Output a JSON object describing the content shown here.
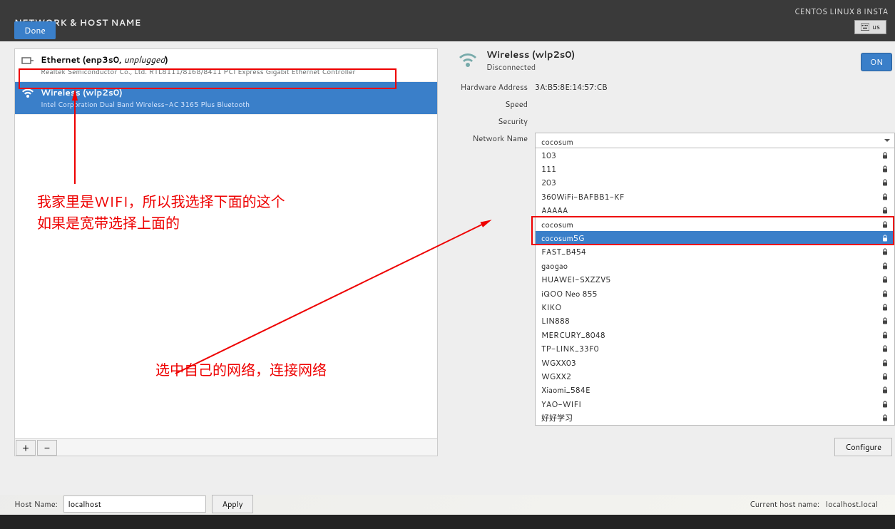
{
  "topbar": {
    "title": "NETWORK & HOST NAME",
    "distro": "CENTOS LINUX 8 INSTA",
    "keyboard": "us",
    "done_label": "Done"
  },
  "devices": [
    {
      "name": "Ethernet (enp3s0, ",
      "unplugged": "unplugged",
      "nameSuffix": ")",
      "sub": "Realtek Semiconductor Co., Ltd. RTL8111/8168/8411 PCI Express Gigabit Ethernet Controller",
      "selected": false,
      "iconType": "ethernet"
    },
    {
      "name": "Wireless (wlp2s0)",
      "unplugged": "",
      "nameSuffix": "",
      "sub": "Intel Corporation Dual Band Wireless-AC 3165 Plus Bluetooth",
      "selected": true,
      "iconType": "wifi"
    }
  ],
  "toolbar": {
    "add": "+",
    "remove": "−"
  },
  "details": {
    "title": "Wireless (wlp2s0)",
    "status": "Disconnected",
    "on_label": "ON",
    "rows": {
      "hw_label": "Hardware Address",
      "hw_value": "3A:B5:8E:14:57:CB",
      "speed_label": "Speed",
      "speed_value": "",
      "security_label": "Security",
      "security_value": "",
      "network_label": "Network Name",
      "network_selected": "cocosum"
    },
    "configure_label": "Configure"
  },
  "networks": [
    {
      "name": "103",
      "locked": true
    },
    {
      "name": "111",
      "locked": true
    },
    {
      "name": "203",
      "locked": true
    },
    {
      "name": "360WiFi-BAFBB1-KF",
      "locked": true
    },
    {
      "name": "AAAAA",
      "locked": true
    },
    {
      "name": "cocosum",
      "locked": true,
      "boxed": true
    },
    {
      "name": "cocosum5G",
      "locked": true,
      "highlighted": true
    },
    {
      "name": "FAST_B454",
      "locked": true
    },
    {
      "name": "gaogao",
      "locked": true
    },
    {
      "name": "HUAWEI-SXZZV5",
      "locked": true
    },
    {
      "name": "iQOO Neo 855",
      "locked": true
    },
    {
      "name": "KIKO",
      "locked": true
    },
    {
      "name": "LIN888",
      "locked": true
    },
    {
      "name": "MERCURY_8048",
      "locked": true
    },
    {
      "name": "TP-LINK_33F0",
      "locked": true
    },
    {
      "name": "WGXX03",
      "locked": true
    },
    {
      "name": "WGXX2",
      "locked": true
    },
    {
      "name": "Xiaomi_584E",
      "locked": true
    },
    {
      "name": "YAO-WIFI",
      "locked": true
    },
    {
      "name": "好好学习",
      "locked": true
    }
  ],
  "hostname": {
    "label": "Host Name:",
    "value": "localhost",
    "apply": "Apply",
    "current_label": "Current host name:",
    "current_value": "localhost.local"
  },
  "annotations": {
    "text1_line1": "我家里是WIFI，所以我选择下面的这个",
    "text1_line2": "如果是宽带选择上面的",
    "text2": "选中自己的网络，连接网络"
  }
}
